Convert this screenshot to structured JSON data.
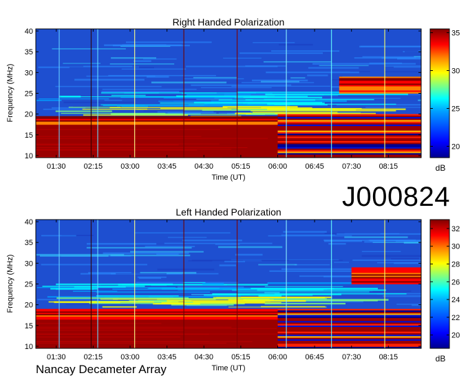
{
  "figure_id": "J000824",
  "footer": "Nancay Decameter Array",
  "colors": {
    "background_blue": "#1e4fd0",
    "saturated_red": "#9a0000",
    "colormap": [
      "#00008f",
      "#0000ff",
      "#00a0ff",
      "#00ffff",
      "#80ff80",
      "#ffff00",
      "#ff8000",
      "#ff0000",
      "#800000"
    ]
  },
  "chart_data": [
    {
      "type": "heatmap",
      "title": "Right Handed Polarization",
      "xlabel": "Time (UT)",
      "ylabel": "Frequency (MHz)",
      "x_ticks": [
        "01:30",
        "02:15",
        "03:00",
        "03:45",
        "04:30",
        "05:15",
        "06:00",
        "06:45",
        "07:30",
        "08:15"
      ],
      "x_range_ut": [
        "01:05",
        "08:55"
      ],
      "y_ticks": [
        10,
        15,
        20,
        25,
        30,
        35,
        40
      ],
      "ylim": [
        9.5,
        40.5
      ],
      "colorbar": {
        "label": "dB",
        "ticks": [
          20,
          25,
          30,
          35
        ],
        "range": [
          18.5,
          35.5
        ]
      },
      "grid": false,
      "bands": [
        {
          "f_low": 9.5,
          "f_high": 17.5,
          "t_start": "01:05",
          "t_end": "06:00",
          "level": "saturated"
        },
        {
          "f_low": 17.5,
          "f_high": 19.5,
          "t_start": "01:05",
          "t_end": "06:00",
          "level": "high"
        },
        {
          "f_low": 9.5,
          "f_high": 20.0,
          "t_start": "06:00",
          "t_end": "08:55",
          "level": "mixed"
        },
        {
          "f_low": 25.0,
          "f_high": 29.0,
          "t_start": "07:15",
          "t_end": "08:55",
          "level": "high"
        }
      ]
    },
    {
      "type": "heatmap",
      "title": "Left Handed Polarization",
      "xlabel": "Time (UT)",
      "ylabel": "Frequency (MHz)",
      "x_ticks": [
        "01:30",
        "02:15",
        "03:00",
        "03:45",
        "04:30",
        "05:15",
        "06:00",
        "06:45",
        "07:30",
        "08:15"
      ],
      "x_range_ut": [
        "01:05",
        "08:55"
      ],
      "y_ticks": [
        10,
        15,
        20,
        25,
        30,
        35,
        40
      ],
      "ylim": [
        9.5,
        40.5
      ],
      "colorbar": {
        "label": "dB",
        "ticks": [
          20,
          22,
          24,
          26,
          28,
          30,
          32
        ],
        "range": [
          18.5,
          33.0
        ]
      },
      "grid": false,
      "bands": [
        {
          "f_low": 9.5,
          "f_high": 16.5,
          "t_start": "01:05",
          "t_end": "06:00",
          "level": "saturated"
        },
        {
          "f_low": 16.5,
          "f_high": 19.0,
          "t_start": "01:05",
          "t_end": "06:00",
          "level": "high"
        },
        {
          "f_low": 9.5,
          "f_high": 19.0,
          "t_start": "06:00",
          "t_end": "08:55",
          "level": "mixed"
        },
        {
          "f_low": 25.0,
          "f_high": 29.0,
          "t_start": "07:30",
          "t_end": "08:55",
          "level": "high"
        }
      ]
    }
  ]
}
